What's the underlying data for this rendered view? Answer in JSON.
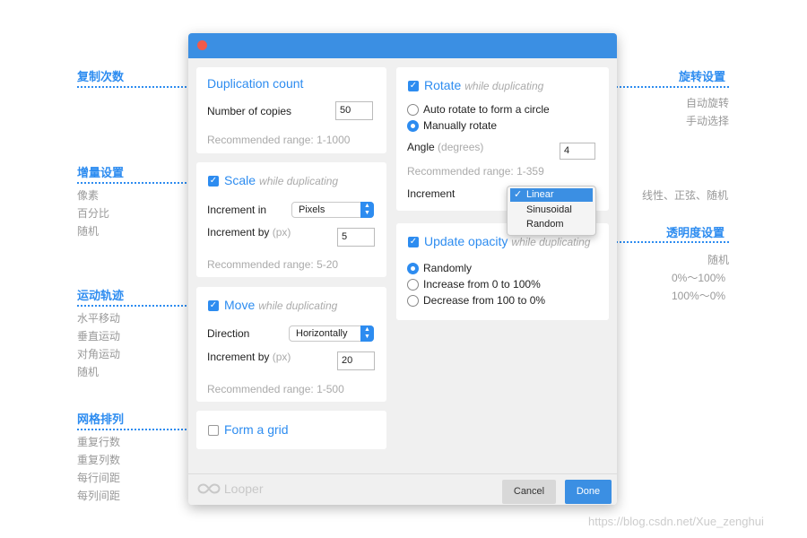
{
  "annotations": {
    "left": [
      {
        "title": "复制次数",
        "items": []
      },
      {
        "title": "增量设置",
        "items": [
          "像素",
          "百分比",
          "随机"
        ]
      },
      {
        "title": "运动轨迹",
        "items": [
          "水平移动",
          "垂直运动",
          "对角运动",
          "随机"
        ]
      },
      {
        "title": "网格排列",
        "items": [
          "重复行数",
          "重复列数",
          "每行间距",
          "每列间距"
        ]
      }
    ],
    "right": [
      {
        "title": "旋转设置",
        "items": [
          "自动旋转",
          "手动选择"
        ]
      },
      {
        "title": "",
        "items": [
          "线性、正弦、随机"
        ]
      },
      {
        "title": "透明度设置",
        "items": [
          "随机",
          "0%～100%",
          "100%～0%"
        ]
      }
    ]
  },
  "duplication": {
    "title": "Duplication count",
    "copies_label": "Number of copies",
    "copies_value": "50",
    "hint": "Recommended range: 1-1000"
  },
  "scale": {
    "title": "Scale",
    "subtitle": "while duplicating",
    "increment_in_label": "Increment in",
    "increment_in_value": "Pixels",
    "increment_by_label": "Increment by",
    "unit": "(px)",
    "increment_by_value": "5",
    "hint": "Recommended range: 5-20"
  },
  "move": {
    "title": "Move",
    "subtitle": "while duplicating",
    "direction_label": "Direction",
    "direction_value": "Horizontally",
    "increment_by_label": "Increment by",
    "unit": "(px)",
    "increment_by_value": "20",
    "hint": "Recommended range: 1-500"
  },
  "grid": {
    "title": "Form a grid"
  },
  "rotate": {
    "title": "Rotate",
    "subtitle": "while duplicating",
    "option_auto": "Auto rotate to form a circle",
    "option_manual": "Manually rotate",
    "angle_label": "Angle",
    "angle_unit": "(degrees)",
    "angle_value": "4",
    "hint": "Recommended range: 1-359",
    "increment_label": "Increment",
    "increment_options": [
      "Linear",
      "Sinusoidal",
      "Random"
    ],
    "increment_selected": "Linear",
    "check_glyph": "✓"
  },
  "opacity": {
    "title": "Update opacity",
    "subtitle": "while duplicating",
    "option_random": "Randomly",
    "option_increase": "Increase from 0 to 100%",
    "option_decrease": "Decrease from 100 to 0%"
  },
  "footer": {
    "logo_icon": "infinity-icon",
    "logo_text": "Looper",
    "cancel_label": "Cancel",
    "done_label": "Done"
  },
  "watermark": "https://blog.csdn.net/Xue_zenghui",
  "colors": {
    "accent": "#2d8cf0",
    "titlebar": "#3b8fe3",
    "close": "#f05a4a"
  }
}
